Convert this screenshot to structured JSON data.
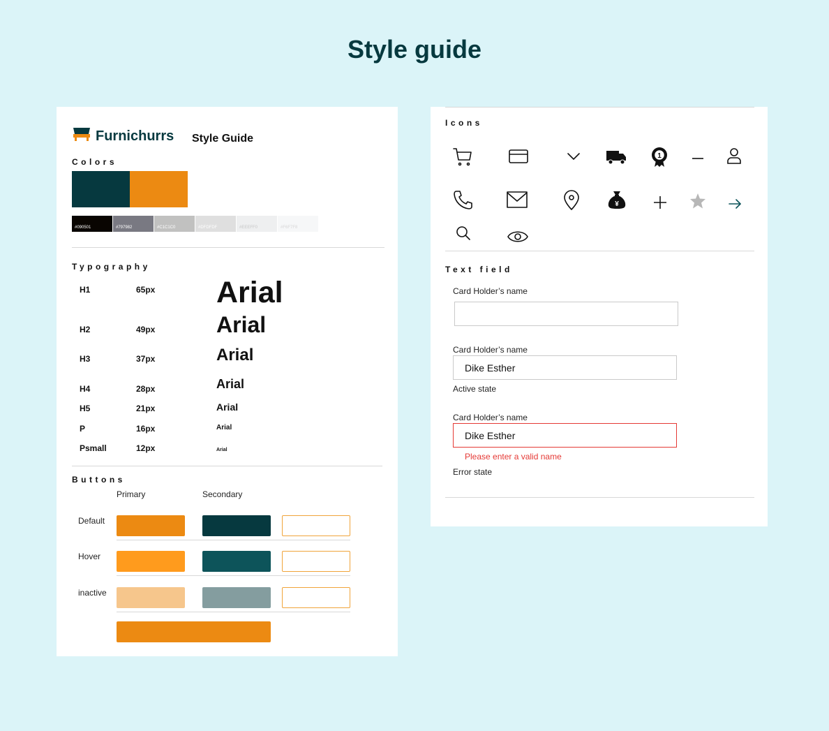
{
  "page_title": "Style guide",
  "brand": {
    "name": "Furnichurrs",
    "subtitle": "Style Guide"
  },
  "colors": {
    "label": "Colors",
    "primary": [
      "#06393f",
      "#ec8a12"
    ],
    "grays": [
      {
        "hex": "#090501",
        "label": "#090501",
        "text_color": "#ffffff"
      },
      {
        "hex": "#797982",
        "label": "#797982",
        "text_color": "#ffffff"
      },
      {
        "hex": "#C1C1C0",
        "label": "#C1C1C0",
        "text_color": "#ffffff"
      },
      {
        "hex": "#DFDFDF",
        "label": "#DFDFDF",
        "text_color": "#ffffff"
      },
      {
        "hex": "#EEEFF0",
        "label": "#EEEFF0",
        "text_color": "#ffffff"
      },
      {
        "hex": "#F6F7F8",
        "label": "#F6F7F8",
        "text_color": "#ffffff"
      }
    ]
  },
  "typography": {
    "label": "Typography",
    "sample": "Arial",
    "rows": [
      {
        "name": "H1",
        "size": "65px"
      },
      {
        "name": "H2",
        "size": "49px"
      },
      {
        "name": "H3",
        "size": "37px"
      },
      {
        "name": "H4",
        "size": "28px"
      },
      {
        "name": "H5",
        "size": "21px"
      },
      {
        "name": "P",
        "size": "16px"
      },
      {
        "name": "Psmall",
        "size": "12px"
      }
    ]
  },
  "buttons": {
    "label": "Buttons",
    "columns": [
      "Primary",
      "Secondary"
    ],
    "rows": [
      {
        "state": "Default",
        "primary": "#ec8a12",
        "secondary": "#06393f"
      },
      {
        "state": "Hover",
        "primary": "#ff9b1d",
        "secondary": "#0d545a"
      },
      {
        "state": "inactive",
        "primary": "#f6c68c",
        "secondary": "#849d9f"
      }
    ],
    "wide_color": "#ec8a12"
  },
  "icons": {
    "label": "Icons",
    "items": [
      "cart-icon",
      "card-icon",
      "chevron-down-icon",
      "truck-icon",
      "medal-icon",
      "minus-icon",
      "user-icon",
      "phone-icon",
      "mail-icon",
      "location-pin-icon",
      "money-bag-icon",
      "plus-icon",
      "star-icon",
      "arrow-right-icon",
      "search-icon",
      "eye-icon"
    ]
  },
  "text_field": {
    "label": "Text field",
    "fields": [
      {
        "label": "Card Holder’s name",
        "value": ""
      },
      {
        "label": "Card Holder’s name",
        "value": "Dike Esther",
        "state": "Active state"
      },
      {
        "label": "Card Holder’s name",
        "value": "Dike Esther",
        "error": "Please enter a valid name",
        "state": "Error state"
      }
    ]
  }
}
